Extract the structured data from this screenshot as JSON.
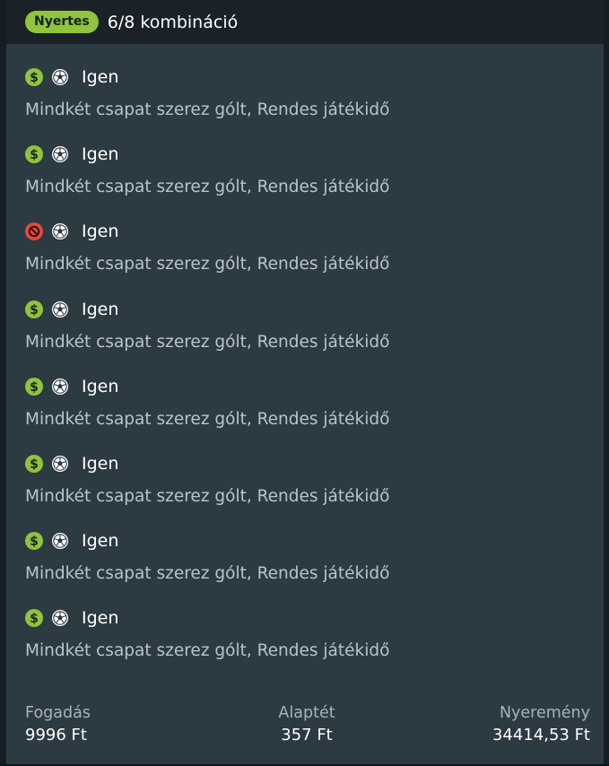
{
  "header": {
    "badge": "Nyertes",
    "summary": "6/8 kombináció"
  },
  "legs": [
    {
      "status": "won",
      "status_icon": "dollar-icon",
      "sport_icon": "soccer-ball-icon",
      "pick": "Igen",
      "market": "Mindkét csapat szerez gólt, Rendes játékidő"
    },
    {
      "status": "won",
      "status_icon": "dollar-icon",
      "sport_icon": "soccer-ball-icon",
      "pick": "Igen",
      "market": "Mindkét csapat szerez gólt, Rendes játékidő"
    },
    {
      "status": "lost",
      "status_icon": "blocked-icon",
      "sport_icon": "soccer-ball-icon",
      "pick": "Igen",
      "market": "Mindkét csapat szerez gólt, Rendes játékidő"
    },
    {
      "status": "won",
      "status_icon": "dollar-icon",
      "sport_icon": "soccer-ball-icon",
      "pick": "Igen",
      "market": "Mindkét csapat szerez gólt, Rendes játékidő"
    },
    {
      "status": "won",
      "status_icon": "dollar-icon",
      "sport_icon": "soccer-ball-icon",
      "pick": "Igen",
      "market": "Mindkét csapat szerez gólt, Rendes játékidő"
    },
    {
      "status": "won",
      "status_icon": "dollar-icon",
      "sport_icon": "soccer-ball-icon",
      "pick": "Igen",
      "market": "Mindkét csapat szerez gólt, Rendes játékidő"
    },
    {
      "status": "won",
      "status_icon": "dollar-icon",
      "sport_icon": "soccer-ball-icon",
      "pick": "Igen",
      "market": "Mindkét csapat szerez gólt, Rendes játékidő"
    },
    {
      "status": "won",
      "status_icon": "dollar-icon",
      "sport_icon": "soccer-ball-icon",
      "pick": "Igen",
      "market": "Mindkét csapat szerez gólt, Rendes játékidő"
    }
  ],
  "footer": {
    "stake_label": "Fogadás",
    "stake_value": "9996 Ft",
    "base_label": "Alaptét",
    "base_value": "357 Ft",
    "win_label": "Nyeremény",
    "win_value": "34414,53 Ft"
  },
  "colors": {
    "accent_green": "#8fc43c",
    "lost_red": "#e5483c",
    "card_bg": "#2c3a42",
    "header_bg": "#1a2228"
  }
}
